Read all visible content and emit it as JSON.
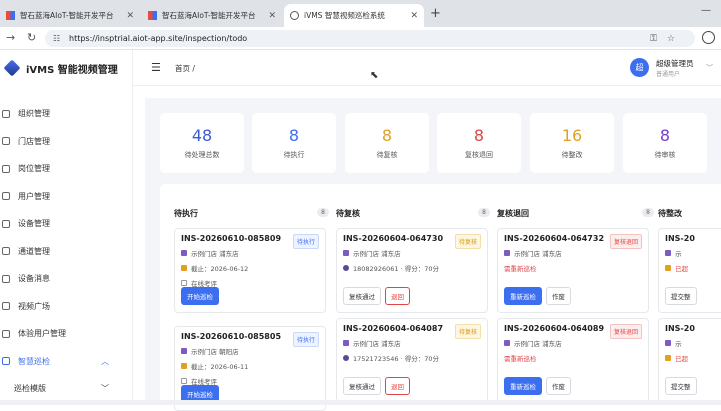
{
  "browser": {
    "tabs": [
      {
        "title": "智石蓝海AIoT-智能开发平台"
      },
      {
        "title": "智石蓝海AIoT-智能开发平台"
      },
      {
        "title": "iVMS 智慧视频巡检系统"
      }
    ],
    "url": "https://insptrial.aiot-app.site/inspection/todo"
  },
  "app": {
    "title": "iVMS 智能视频管理"
  },
  "sidebar": {
    "items": [
      {
        "label": "组织管理"
      },
      {
        "label": "门店管理"
      },
      {
        "label": "岗位管理"
      },
      {
        "label": "用户管理"
      },
      {
        "label": "设备管理"
      },
      {
        "label": "通道管理"
      },
      {
        "label": "设备消息"
      },
      {
        "label": "视频广场"
      },
      {
        "label": "体验用户管理"
      },
      {
        "label": "智慧巡检"
      },
      {
        "label": "巡检模版"
      }
    ]
  },
  "header": {
    "breadcrumb": "首页 /",
    "user_name": "超级管理员",
    "user_role": "普通用户",
    "avatar_text": "超"
  },
  "stats": [
    {
      "value": "48",
      "label": "待处理总数",
      "color": "#3c5bd6"
    },
    {
      "value": "8",
      "label": "待执行",
      "color": "#3c6ff0"
    },
    {
      "value": "8",
      "label": "待复核",
      "color": "#e2a020"
    },
    {
      "value": "8",
      "label": "复核退回",
      "color": "#e04545"
    },
    {
      "value": "16",
      "label": "待整改",
      "color": "#e2a020"
    },
    {
      "value": "8",
      "label": "待审核",
      "color": "#7a3fc8"
    }
  ],
  "columns": [
    {
      "title": "待执行",
      "count": "8"
    },
    {
      "title": "待复核",
      "count": "8"
    },
    {
      "title": "复核退回",
      "count": "8"
    },
    {
      "title": "待整改",
      "count": ""
    }
  ],
  "cards": {
    "c1a": {
      "id": "INS-20260610-085809",
      "badge": "待执行",
      "store": "示例门店 浦东店",
      "line2": "截止：2026-06-12",
      "line3": "在线考评",
      "btn1": "开始巡检"
    },
    "c1b": {
      "id": "INS-20260610-085805",
      "badge": "待执行",
      "store": "示例门店 朝阳店",
      "line2": "截止：2026-06-11",
      "line3": "在线考评",
      "btn1": "开始巡检"
    },
    "c2a": {
      "id": "INS-20260604-064730",
      "badge": "待复核",
      "store": "示例门店 浦东店",
      "line2": "18082926061 · 得分：70分",
      "btn1": "复核通过",
      "btn2": "退回"
    },
    "c2b": {
      "id": "INS-20260604-064087",
      "badge": "待复核",
      "store": "示例门店 浦东店",
      "line2": "17521723546 · 得分：70分",
      "btn1": "复核通过",
      "btn2": "退回"
    },
    "c3a": {
      "id": "INS-20260604-064732",
      "badge": "复核退回",
      "store": "示例门店 浦东店",
      "line2": "需重新巡检",
      "btn1": "重新巡检",
      "btn2": "作废"
    },
    "c3b": {
      "id": "INS-20260604-064089",
      "badge": "复核退回",
      "store": "示例门店 浦东店",
      "line2": "需重新巡检",
      "btn1": "重新巡检",
      "btn2": "作废"
    },
    "c4a": {
      "id": "INS-20",
      "store": "示",
      "line2": "已超",
      "btn1": "提交整"
    },
    "c4b": {
      "id": "INS-20",
      "store": "示",
      "line2": "已超",
      "btn1": "提交整"
    }
  }
}
